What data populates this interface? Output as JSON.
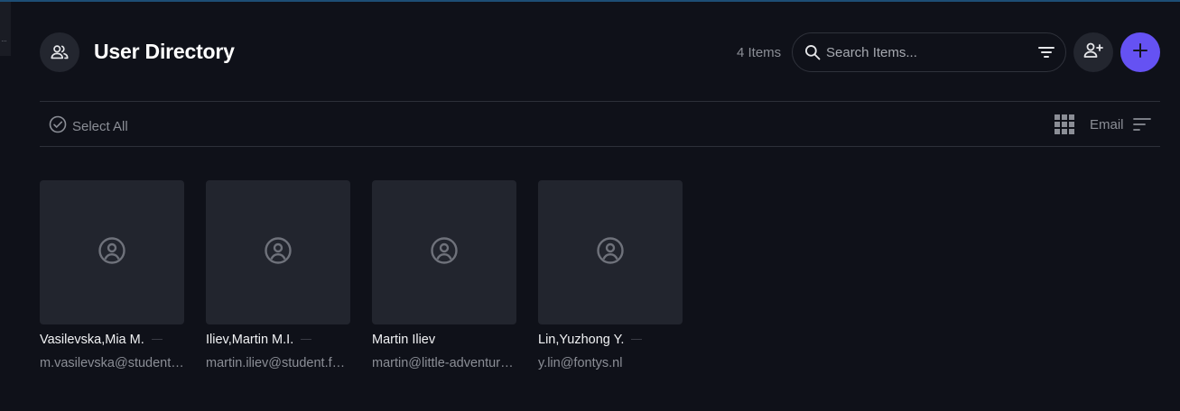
{
  "header": {
    "title": "User Directory",
    "item_count": "4 Items",
    "search_placeholder": "Search Items..."
  },
  "toolbar": {
    "select_all_label": "Select All",
    "sort_label": "Email"
  },
  "users": [
    {
      "name": "Vasilevska,Mia M.",
      "email": "m.vasilevska@student.fontys.nl"
    },
    {
      "name": "Iliev,Martin M.I.",
      "email": "martin.iliev@student.fontys.nl"
    },
    {
      "name": "Martin Iliev",
      "email": "martin@little-adventures.nl"
    },
    {
      "name": "Lin,Yuzhong Y.",
      "email": "y.lin@fontys.nl"
    }
  ],
  "colors": {
    "background": "#0f1119",
    "card": "#22252e",
    "accent": "#6552f3",
    "muted_text": "#8b8e96"
  },
  "icons": {
    "title": "users-icon",
    "search": "search-icon",
    "filter": "filter-icon",
    "add_user": "person-add-icon",
    "add": "plus-icon",
    "select_all": "check-circle-icon",
    "view": "grid-view-icon",
    "sort": "sort-icon",
    "avatar": "user-circle-icon"
  }
}
